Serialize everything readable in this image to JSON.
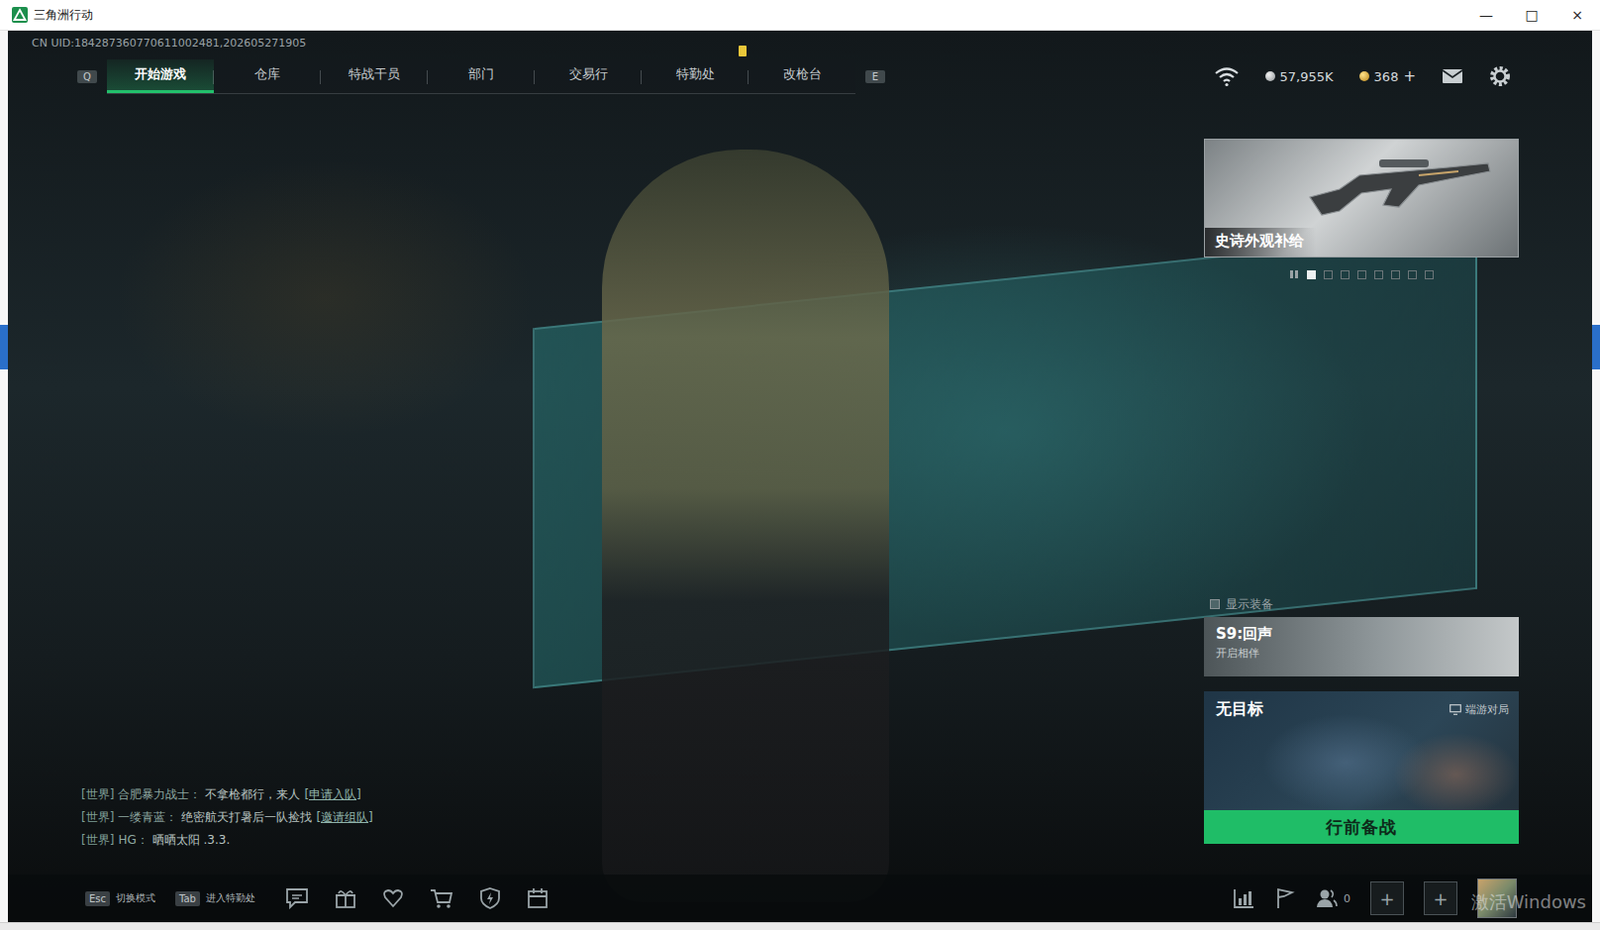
{
  "window": {
    "title": "三角洲行动",
    "controls": [
      "—",
      "□",
      "×"
    ]
  },
  "uid": "CN UID:184287360770611002481,202605271905",
  "nav": {
    "prev_key": "Q",
    "next_key": "E",
    "tabs": [
      {
        "label": "开始游戏",
        "selected": true,
        "notice": false
      },
      {
        "label": "仓库",
        "selected": false,
        "notice": false
      },
      {
        "label": "特战干员",
        "selected": false,
        "notice": false
      },
      {
        "label": "部门",
        "selected": false,
        "notice": false
      },
      {
        "label": "交易行",
        "selected": false,
        "notice": false
      },
      {
        "label": "特勤处",
        "selected": false,
        "notice": true
      },
      {
        "label": "改枪台",
        "selected": false,
        "notice": false
      }
    ]
  },
  "currencies": [
    {
      "amount": "57,955K",
      "kind": "silver",
      "add": ""
    },
    {
      "amount": "368",
      "kind": "gold",
      "add": "+"
    }
  ],
  "promo": {
    "title": "史诗外观补给"
  },
  "pager": [
    {
      "selected": true
    },
    {
      "selected": false
    },
    {
      "selected": false
    },
    {
      "selected": false
    },
    {
      "selected": false
    },
    {
      "selected": false
    },
    {
      "selected": false
    },
    {
      "selected": false
    }
  ],
  "show_equipment": {
    "label": "显示装备",
    "checked": false
  },
  "season": {
    "title": "S9:回声",
    "subtitle": "开启相伴"
  },
  "mode": {
    "title": "无目标",
    "platform": "端游对局",
    "button": "行前备战"
  },
  "chat": [
    {
      "channel": "[世界]",
      "name": "合肥暴力战士：",
      "text": "不拿枪都行，来人",
      "action": "[申请入队]"
    },
    {
      "channel": "[世界]",
      "name": "一缕青蓝：",
      "text": "绝密航天打暑后一队捡找",
      "action": "[邀请组队]"
    },
    {
      "channel": "[世界]",
      "name": "HG：",
      "text": "晒晒太阳 .3.3.",
      "action": ""
    }
  ],
  "shortcuts": [
    {
      "key": "Esc",
      "label": "切换模式"
    },
    {
      "key": "Tab",
      "label": "进入特勤处"
    }
  ],
  "friends": {
    "online": "0"
  },
  "squad_slots": [
    {
      "label": "+"
    },
    {
      "label": "+"
    }
  ],
  "watermark": "激活Windows"
}
